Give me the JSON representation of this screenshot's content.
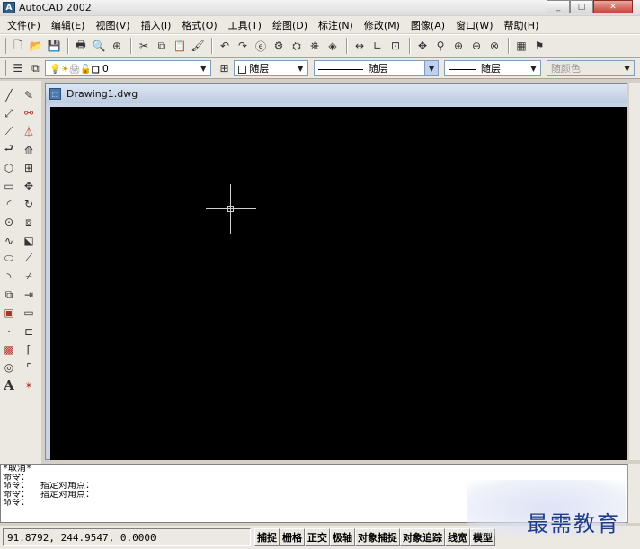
{
  "window": {
    "title": "AutoCAD 2002",
    "app_icon": "A",
    "controls": [
      "_",
      "□",
      "✕"
    ]
  },
  "menubar": [
    "文件(F)",
    "编辑(E)",
    "视图(V)",
    "插入(I)",
    "格式(O)",
    "工具(T)",
    "绘图(D)",
    "标注(N)",
    "修改(M)",
    "图像(A)",
    "窗口(W)",
    "帮助(H)"
  ],
  "standard_toolbar_icons": [
    {
      "name": "new-icon",
      "glyph": "🗋"
    },
    {
      "name": "open-icon",
      "glyph": "📂"
    },
    {
      "name": "save-icon",
      "glyph": "💾"
    },
    "sep",
    {
      "name": "print-icon",
      "glyph": "🖶"
    },
    {
      "name": "print-preview-icon",
      "glyph": "🔍"
    },
    {
      "name": "publish-icon",
      "glyph": "⊕"
    },
    "sep",
    {
      "name": "cut-icon",
      "glyph": "✂"
    },
    {
      "name": "copy-icon",
      "glyph": "⧉"
    },
    {
      "name": "paste-icon",
      "glyph": "📋"
    },
    {
      "name": "match-properties-icon",
      "glyph": "🖌"
    },
    "sep",
    {
      "name": "undo-icon",
      "glyph": "↶"
    },
    {
      "name": "redo-icon",
      "glyph": "↷"
    },
    {
      "name": "hyperlink-icon",
      "glyph": "ⓔ"
    },
    {
      "name": "object-snap-icon",
      "glyph": "⚙"
    },
    {
      "name": "ucs-icon",
      "glyph": "⛭"
    },
    {
      "name": "named-views-icon",
      "glyph": "⛯"
    },
    {
      "name": "viewpoint-icon",
      "glyph": "◈"
    },
    "sep",
    {
      "name": "distance-icon",
      "glyph": "↔"
    },
    {
      "name": "ucs-axis-icon",
      "glyph": "∟"
    },
    {
      "name": "aerial-view-icon",
      "glyph": "⊡"
    },
    "sep",
    {
      "name": "pan-icon",
      "glyph": "✥"
    },
    {
      "name": "zoom-realtime-icon",
      "glyph": "⚲"
    },
    {
      "name": "zoom-window-icon",
      "glyph": "⊕"
    },
    {
      "name": "zoom-previous-icon",
      "glyph": "⊖"
    },
    {
      "name": "zoom-extents-icon",
      "glyph": "⊗"
    },
    "sep",
    {
      "name": "properties-icon",
      "glyph": "▦"
    },
    {
      "name": "design-center-icon",
      "glyph": "⚑"
    }
  ],
  "layers_toolbar": {
    "current_layer": "0",
    "layer_icons": [
      "💡",
      "☀",
      "🖨",
      "🔓",
      "■"
    ]
  },
  "properties_toolbar": {
    "color": "随层",
    "linetype": "随层",
    "lineweight": "随层",
    "plotstyle": "随颜色"
  },
  "draw_tools": [
    {
      "name": "line-icon",
      "glyph": "╱"
    },
    {
      "name": "construction-line-icon",
      "glyph": "⤢"
    },
    {
      "name": "polyline-icon",
      "glyph": "⟋"
    },
    {
      "name": "polygon-icon",
      "glyph": "⮐"
    },
    {
      "name": "polygon-shape-icon",
      "glyph": "⬡"
    },
    {
      "name": "rectangle-icon",
      "glyph": "▭"
    },
    {
      "name": "arc-icon",
      "glyph": "◜"
    },
    {
      "name": "circle-icon",
      "glyph": "⊙"
    },
    {
      "name": "spline-icon",
      "glyph": "∿"
    },
    {
      "name": "ellipse-icon",
      "glyph": "⬭"
    },
    {
      "name": "ellipse-arc-icon",
      "glyph": "◝"
    },
    {
      "name": "insert-block-icon",
      "glyph": "⧉"
    },
    {
      "name": "make-block-icon",
      "glyph": "▣"
    },
    {
      "name": "point-icon",
      "glyph": "·"
    },
    {
      "name": "hatch-icon",
      "glyph": "▩"
    },
    {
      "name": "region-icon",
      "glyph": "◎"
    },
    {
      "name": "multiline-text-icon",
      "glyph": "A"
    }
  ],
  "modify_tools": [
    {
      "name": "erase-icon",
      "glyph": "✎"
    },
    {
      "name": "copy-object-icon",
      "glyph": "⚯"
    },
    {
      "name": "mirror-icon",
      "glyph": "⏅"
    },
    {
      "name": "offset-icon",
      "glyph": "⟰"
    },
    {
      "name": "array-icon",
      "glyph": "⊞"
    },
    {
      "name": "move-icon",
      "glyph": "✥"
    },
    {
      "name": "rotate-icon",
      "glyph": "↻"
    },
    {
      "name": "scale-icon",
      "glyph": "⧈"
    },
    {
      "name": "stretch-icon",
      "glyph": "⬕"
    },
    {
      "name": "lengthen-icon",
      "glyph": "⟋"
    },
    {
      "name": "trim-icon",
      "glyph": "⌿"
    },
    {
      "name": "extend-icon",
      "glyph": "⇥"
    },
    {
      "name": "break-icon",
      "glyph": "▭"
    },
    {
      "name": "break-at-point-icon",
      "glyph": "⊏"
    },
    {
      "name": "chamfer-icon",
      "glyph": "⌈"
    },
    {
      "name": "fillet-icon",
      "glyph": "⌜"
    },
    {
      "name": "explode-icon",
      "glyph": "✴"
    }
  ],
  "drawing": {
    "tab_name": "Drawing1.dwg",
    "background": "#000000"
  },
  "command_lines": [
    "*取消*",
    "命令：",
    "命令：  指定对角点：",
    "命令：  指定对角点：",
    "命令："
  ],
  "status": {
    "coordinates": "91.8792, 244.9547, 0.0000",
    "buttons": [
      "捕捉",
      "栅格",
      "正交",
      "极轴",
      "对象捕捉",
      "对象追踪",
      "线宽",
      "模型"
    ]
  },
  "watermark": "最需教育"
}
